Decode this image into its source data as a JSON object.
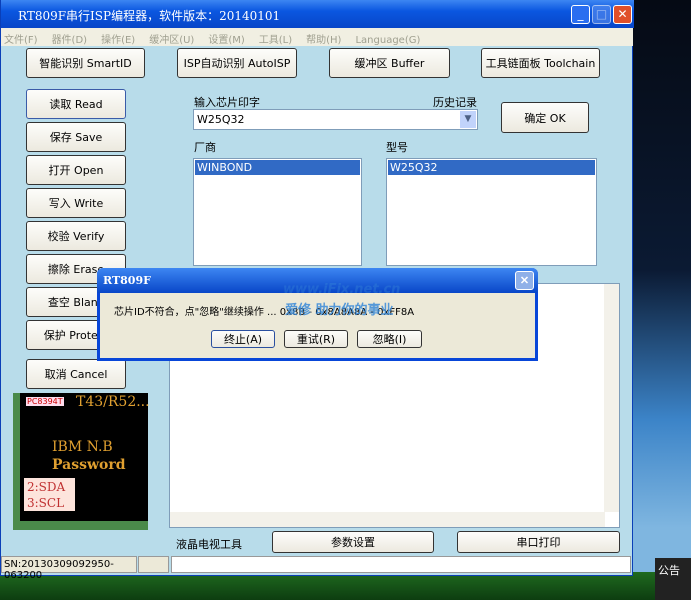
{
  "window": {
    "title": "RT809F串行ISP编程器，软件版本：20140101"
  },
  "menu": [
    "文件(F)",
    "器件(D)",
    "操作(E)",
    "缓冲区(U)",
    "设置(M)",
    "工具(L)",
    "帮助(H)",
    "Language(G)"
  ],
  "top_buttons": [
    "智能识别 SmartID",
    "ISP自动识别 AutoISP",
    "缓冲区 Buffer",
    "工具链面板 Toolchain"
  ],
  "left_buttons": [
    "读取 Read",
    "保存 Save",
    "打开 Open",
    "写入 Write",
    "校验 Verify",
    "擦除 Erase",
    "查空 Blank",
    "保护 Protect",
    "取消 Cancel"
  ],
  "chip_input": {
    "label": "输入芯片印字",
    "history_label": "历史记录",
    "value": "W25Q32",
    "ok": "确定 OK"
  },
  "vendor": {
    "label": "厂商",
    "items": [
      "WINBOND"
    ]
  },
  "model": {
    "label": "型号",
    "items": [
      "W25Q32"
    ]
  },
  "chip_image": {
    "tag": "PC8394T",
    "model": "T43/R52...",
    "line1": "IBM  N.B",
    "line2": "Password",
    "pin1": "2:SDA",
    "pin2": "3:SCL"
  },
  "bottom": {
    "label": "液晶电视工具",
    "params": "参数设置",
    "serial": "串口打印"
  },
  "status": {
    "sn": "SN:20130309092950-063200"
  },
  "dialog": {
    "title": "RT809F",
    "message": "芯片ID不符合，点\"忽略\"继续操作 ... 0x8B - 0x8A8A8A - 0xFF8A",
    "abort": "终止(A)",
    "retry": "重试(R)",
    "ignore": "忽略(I)",
    "watermark1": "www.iFix.net.cn",
    "watermark2": "爱修 助力你的事业"
  },
  "desktop": {
    "notice": "公告"
  }
}
